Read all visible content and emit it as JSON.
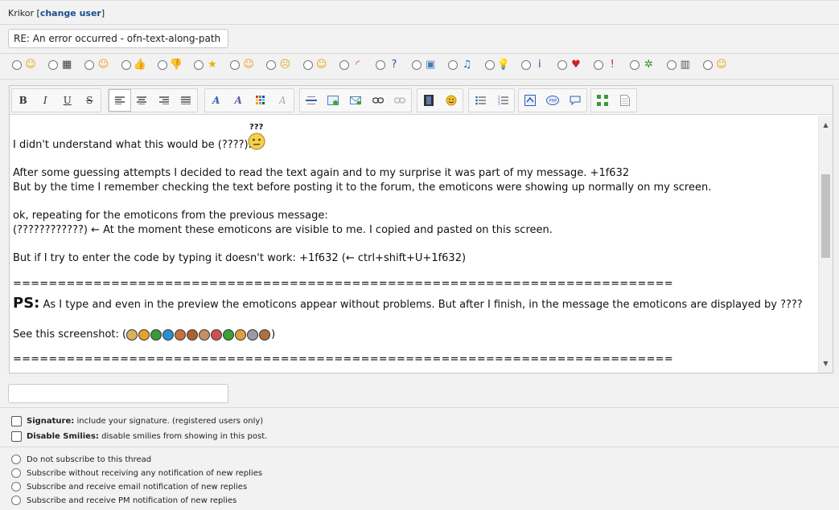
{
  "user": {
    "name": "Krikor",
    "change_user_label": "change user"
  },
  "subject": {
    "value": "RE: An error occurred - ofn-text-along-path"
  },
  "smilies": [
    {
      "name": "smile-icon",
      "glyph": "☺",
      "color": "#e8a21a"
    },
    {
      "name": "film-icon",
      "glyph": "▦",
      "color": "#3a3a3a"
    },
    {
      "name": "tongue-icon",
      "glyph": "☺",
      "color": "#e8a21a"
    },
    {
      "name": "thumbs-up-icon",
      "glyph": "👍",
      "color": "#e09a30"
    },
    {
      "name": "thumbs-down-icon",
      "glyph": "👎",
      "color": "#e09a30"
    },
    {
      "name": "star-icon",
      "glyph": "★",
      "color": "#e8b400"
    },
    {
      "name": "grin-icon",
      "glyph": "☺",
      "color": "#e8a21a"
    },
    {
      "name": "frown-icon",
      "glyph": "☹",
      "color": "#e8a21a"
    },
    {
      "name": "wink-icon",
      "glyph": "☺",
      "color": "#e8a21a"
    },
    {
      "name": "rainbow-icon",
      "glyph": "◜",
      "color": "#d34"
    },
    {
      "name": "question-icon",
      "glyph": "?",
      "color": "#2a4fb0"
    },
    {
      "name": "picture-icon",
      "glyph": "▣",
      "color": "#4a7ab8"
    },
    {
      "name": "music-icon",
      "glyph": "♫",
      "color": "#2a6ac0"
    },
    {
      "name": "lightbulb-icon",
      "glyph": "💡",
      "color": "#e8c000"
    },
    {
      "name": "info-icon",
      "glyph": "i",
      "color": "#2a4fb0"
    },
    {
      "name": "heart-icon",
      "glyph": "♥",
      "color": "#d0202a"
    },
    {
      "name": "exclamation-icon",
      "glyph": "!",
      "color": "#d0202a"
    },
    {
      "name": "bug-icon",
      "glyph": "✲",
      "color": "#3a8a2a"
    },
    {
      "name": "clapper-icon",
      "glyph": "▥",
      "color": "#555"
    },
    {
      "name": "laugh-icon",
      "glyph": "☺",
      "color": "#e8a21a"
    }
  ],
  "toolbar": {
    "bold": "B",
    "italic": "I",
    "underline": "U",
    "strike": "S"
  },
  "content": {
    "confused_label": "???",
    "line1": "I didn't understand what this would be (????).",
    "line2": "After some guessing attempts I decided to read the text again and to my surprise it was part of my message. +1f632",
    "line3": "But by the time I remember checking the text before posting it to the forum, the emoticons were showing up normally on my screen.",
    "line4": "ok, repeating for the emoticons from the previous message:",
    "line5": "(????????????)  ← At the moment these emoticons are visible to me. I copied and pasted on this screen.",
    "line6": "But if I try to enter the code by typing it doesn't work: +1f632 (← ctrl+shift+U+1f632)",
    "separator": "==========================================================================",
    "ps_label": "PS:",
    "ps_text": "As I type and even in the preview the emoticons appear without problems. But after I finish, in the message the emoticons are displayed by ????",
    "screenshot_label": "See this screenshot: (",
    "screenshot_close": ")",
    "separator2": "=========================================================================="
  },
  "emoji_colors": [
    "#d8b060",
    "#e8a030",
    "#3a9a3a",
    "#2a90d0",
    "#c87040",
    "#b06030",
    "#c89060",
    "#d05050",
    "#3aa03a",
    "#e0a040",
    "#9a9aa0",
    "#b07040"
  ],
  "options": {
    "signature_label": "Signature:",
    "signature_desc": "include your signature. (registered users only)",
    "disable_smilies_label": "Disable Smilies:",
    "disable_smilies_desc": "disable smilies from showing in this post."
  },
  "subscribe": [
    "Do not subscribe to this thread",
    "Subscribe without receiving any notification of new replies",
    "Subscribe and receive email notification of new replies",
    "Subscribe and receive PM notification of new replies"
  ]
}
